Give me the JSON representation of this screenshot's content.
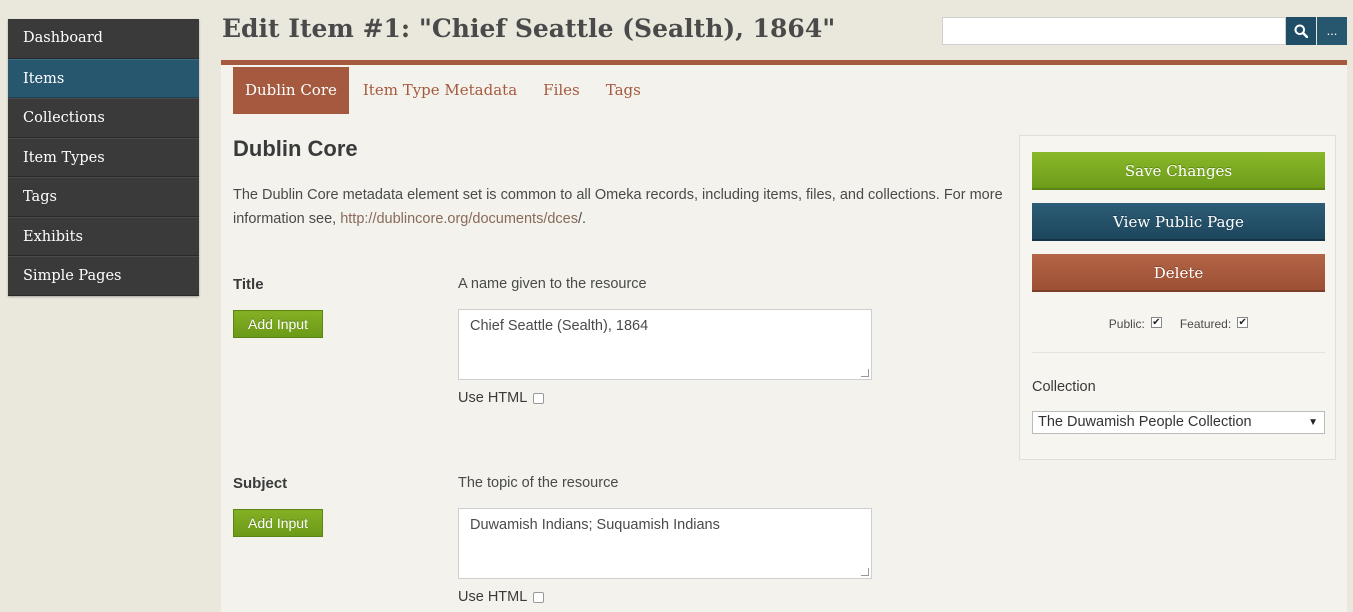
{
  "sidebar": {
    "items": [
      {
        "label": "Dashboard"
      },
      {
        "label": "Items"
      },
      {
        "label": "Collections"
      },
      {
        "label": "Item Types"
      },
      {
        "label": "Tags"
      },
      {
        "label": "Exhibits"
      },
      {
        "label": "Simple Pages"
      }
    ],
    "active": "Items"
  },
  "header": {
    "title": "Edit Item #1: \"Chief Seattle (Sealth), 1864\"",
    "search": {
      "value": "",
      "placeholder": "",
      "more_label": "..."
    }
  },
  "tabs": [
    {
      "label": "Dublin Core",
      "active": true
    },
    {
      "label": "Item Type Metadata",
      "active": false
    },
    {
      "label": "Files",
      "active": false
    },
    {
      "label": "Tags",
      "active": false
    }
  ],
  "section": {
    "title": "Dublin Core",
    "intro_text": "The Dublin Core metadata element set is common to all Omeka records, including items, files, and collections. For more information see, ",
    "intro_link": "http://dublincore.org/documents/dces",
    "intro_end": "/."
  },
  "fields": [
    {
      "label": "Title",
      "description": "A name given to the resource",
      "add_input_label": "Add Input",
      "value": "Chief Seattle (Sealth), 1864",
      "use_html_label": "Use HTML"
    },
    {
      "label": "Subject",
      "description": "The topic of the resource",
      "add_input_label": "Add Input",
      "value": "Duwamish Indians; Suquamish Indians",
      "use_html_label": "Use HTML"
    }
  ],
  "panel": {
    "save_label": "Save Changes",
    "view_label": "View Public Page",
    "delete_label": "Delete",
    "public_label": "Public:",
    "public_checked": true,
    "featured_label": "Featured:",
    "featured_checked": true,
    "collection_label": "Collection",
    "collection_value": "The Duwamish People Collection"
  },
  "colors": {
    "accent": "#a55a3f",
    "nav_active": "#27566f",
    "save": "#7aab22",
    "view": "#254f66",
    "delete": "#a85a3d"
  }
}
